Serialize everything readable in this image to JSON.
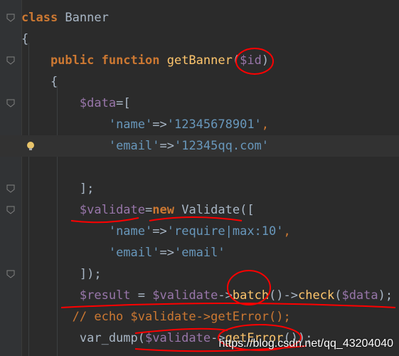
{
  "code_lines": [
    {
      "id": "l1",
      "tokens": [
        {
          "t": "class ",
          "c": "kw"
        },
        {
          "t": "Banner",
          "c": "plain"
        }
      ]
    },
    {
      "id": "l2",
      "tokens": [
        {
          "t": "{",
          "c": "plain"
        }
      ]
    },
    {
      "id": "l3",
      "tokens": [
        {
          "t": "    public ",
          "c": "kw"
        },
        {
          "t": "function ",
          "c": "kw"
        },
        {
          "t": "getBanner",
          "c": "fn"
        },
        {
          "t": "(",
          "c": "plain"
        },
        {
          "t": "$id",
          "c": "var"
        },
        {
          "t": ")",
          "c": "plain"
        }
      ]
    },
    {
      "id": "l4",
      "tokens": [
        {
          "t": "    {",
          "c": "plain"
        }
      ]
    },
    {
      "id": "l5",
      "tokens": [
        {
          "t": "        ",
          "c": "plain"
        },
        {
          "t": "$data",
          "c": "var"
        },
        {
          "t": "=[",
          "c": "plain"
        }
      ]
    },
    {
      "id": "l6",
      "tokens": [
        {
          "t": "            ",
          "c": "plain"
        },
        {
          "t": "'name'",
          "c": "strv"
        },
        {
          "t": "=>",
          "c": "plain"
        },
        {
          "t": "'12345678901'",
          "c": "strv"
        },
        {
          "t": ",",
          "c": "kw2"
        }
      ]
    },
    {
      "id": "l7",
      "tokens": [
        {
          "t": "            ",
          "c": "plain"
        },
        {
          "t": "'email'",
          "c": "strv"
        },
        {
          "t": "=>",
          "c": "plain"
        },
        {
          "t": "'12345qq.com'",
          "c": "strv"
        }
      ]
    },
    {
      "id": "l8",
      "tokens": [
        {
          "t": "",
          "c": "plain"
        }
      ]
    },
    {
      "id": "l9",
      "tokens": [
        {
          "t": "        ];",
          "c": "plain"
        }
      ]
    },
    {
      "id": "l10",
      "tokens": [
        {
          "t": "        ",
          "c": "plain"
        },
        {
          "t": "$validate",
          "c": "var"
        },
        {
          "t": "=",
          "c": "plain"
        },
        {
          "t": "new ",
          "c": "kw"
        },
        {
          "t": "Validate([",
          "c": "plain"
        }
      ]
    },
    {
      "id": "l11",
      "tokens": [
        {
          "t": "            ",
          "c": "plain"
        },
        {
          "t": "'name'",
          "c": "strv"
        },
        {
          "t": "=>",
          "c": "plain"
        },
        {
          "t": "'require|max:10'",
          "c": "strv"
        },
        {
          "t": ",",
          "c": "kw2"
        }
      ]
    },
    {
      "id": "l12",
      "tokens": [
        {
          "t": "            ",
          "c": "plain"
        },
        {
          "t": "'email'",
          "c": "strv"
        },
        {
          "t": "=>",
          "c": "plain"
        },
        {
          "t": "'email'",
          "c": "strv"
        }
      ]
    },
    {
      "id": "l13",
      "tokens": [
        {
          "t": "        ]);",
          "c": "plain"
        }
      ]
    },
    {
      "id": "l14",
      "tokens": [
        {
          "t": "        ",
          "c": "plain"
        },
        {
          "t": "$result",
          "c": "var"
        },
        {
          "t": " = ",
          "c": "plain"
        },
        {
          "t": "$validate",
          "c": "var"
        },
        {
          "t": "->",
          "c": "plain"
        },
        {
          "t": "batch",
          "c": "fn"
        },
        {
          "t": "()->",
          "c": "plain"
        },
        {
          "t": "check",
          "c": "fn"
        },
        {
          "t": "(",
          "c": "plain"
        },
        {
          "t": "$data",
          "c": "var"
        },
        {
          "t": ");",
          "c": "plain"
        }
      ]
    },
    {
      "id": "l15",
      "tokens": [
        {
          "t": "       // echo $validate->getError();",
          "c": "comment"
        }
      ]
    },
    {
      "id": "l16",
      "tokens": [
        {
          "t": "        var_dump(",
          "c": "plain"
        },
        {
          "t": "$validate",
          "c": "var"
        },
        {
          "t": "->",
          "c": "plain"
        },
        {
          "t": "getError",
          "c": "fn"
        },
        {
          "t": "());",
          "c": "plain"
        }
      ]
    }
  ],
  "watermark": "https://blog.csdn.net/qq_43204040",
  "colors": {
    "background": "#2b2b2b",
    "annotation": "#ff0000"
  }
}
